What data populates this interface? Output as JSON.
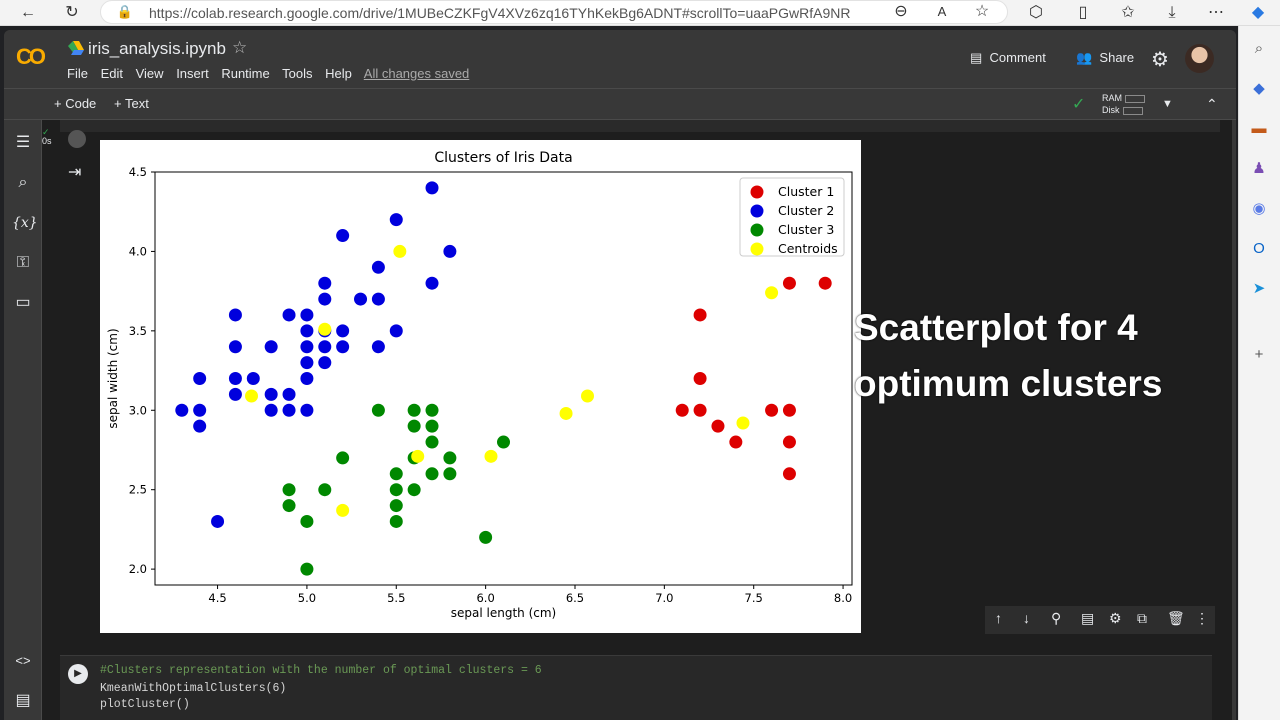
{
  "browser": {
    "url": "https://colab.research.google.com/drive/1MUBeCZKFgV4XVz6zq16TYhKekBg6ADNT#scrollTo=uaaPGwRfA9NR"
  },
  "app": {
    "logo": "CO",
    "title": "iris_analysis.ipynb",
    "menu": [
      "File",
      "Edit",
      "View",
      "Insert",
      "Runtime",
      "Tools",
      "Help"
    ],
    "saved_status": "All changes saved",
    "comment_label": "Comment",
    "share_label": "Share"
  },
  "toolbar": {
    "add_code": "+ Code",
    "add_text": "+ Text",
    "ram_label": "RAM",
    "disk_label": "Disk"
  },
  "cell": {
    "exec_time": "0s",
    "code_lines": [
      "#Clusters representation with the number of optimal clusters = 6",
      "KmeanWithOptimalClusters(6)",
      "plotCluster()"
    ]
  },
  "overlay": {
    "line1": "Scatterplot for 4",
    "line2": "optimum clusters"
  },
  "chart_data": {
    "type": "scatter",
    "title": "Clusters of Iris Data",
    "xlabel": "sepal length (cm)",
    "ylabel": "sepal width (cm)",
    "xlim": [
      4.15,
      8.05
    ],
    "ylim": [
      1.9,
      4.5
    ],
    "xticks": [
      "4.5",
      "5.0",
      "5.5",
      "6.0",
      "6.5",
      "7.0",
      "7.5",
      "8.0"
    ],
    "yticks": [
      "2.0",
      "2.5",
      "3.0",
      "3.5",
      "4.0",
      "4.5"
    ],
    "legend_position": "top-right",
    "series": [
      {
        "name": "Cluster 1",
        "color": "#dd0000",
        "points": [
          [
            7.1,
            3.0
          ],
          [
            7.2,
            3.0
          ],
          [
            7.2,
            3.6
          ],
          [
            7.2,
            3.2
          ],
          [
            7.3,
            2.9
          ],
          [
            7.4,
            2.8
          ],
          [
            7.6,
            3.0
          ],
          [
            7.7,
            3.0
          ],
          [
            7.7,
            3.8
          ],
          [
            7.7,
            2.8
          ],
          [
            7.7,
            2.6
          ],
          [
            7.9,
            3.8
          ]
        ]
      },
      {
        "name": "Cluster 2",
        "color": "#0000dd",
        "points": [
          [
            4.3,
            3.0
          ],
          [
            4.4,
            3.0
          ],
          [
            4.4,
            3.2
          ],
          [
            4.4,
            2.9
          ],
          [
            4.5,
            2.3
          ],
          [
            4.6,
            3.6
          ],
          [
            4.6,
            3.4
          ],
          [
            4.6,
            3.2
          ],
          [
            4.6,
            3.1
          ],
          [
            4.7,
            3.2
          ],
          [
            4.8,
            3.4
          ],
          [
            4.8,
            3.1
          ],
          [
            4.8,
            3.0
          ],
          [
            4.9,
            3.6
          ],
          [
            4.9,
            3.1
          ],
          [
            4.9,
            3.0
          ],
          [
            5.0,
            3.6
          ],
          [
            5.0,
            3.5
          ],
          [
            5.0,
            3.4
          ],
          [
            5.0,
            3.3
          ],
          [
            5.0,
            3.2
          ],
          [
            5.0,
            3.0
          ],
          [
            5.1,
            3.8
          ],
          [
            5.1,
            3.7
          ],
          [
            5.1,
            3.5
          ],
          [
            5.1,
            3.4
          ],
          [
            5.1,
            3.3
          ],
          [
            5.2,
            4.1
          ],
          [
            5.2,
            3.5
          ],
          [
            5.2,
            3.4
          ],
          [
            5.3,
            3.7
          ],
          [
            5.4,
            3.9
          ],
          [
            5.4,
            3.7
          ],
          [
            5.4,
            3.4
          ],
          [
            5.5,
            4.2
          ],
          [
            5.5,
            3.5
          ],
          [
            5.7,
            4.4
          ],
          [
            5.7,
            3.8
          ],
          [
            5.8,
            4.0
          ]
        ]
      },
      {
        "name": "Cluster 3",
        "color": "#008800",
        "points": [
          [
            4.9,
            2.5
          ],
          [
            4.9,
            2.4
          ],
          [
            5.0,
            2.3
          ],
          [
            5.0,
            2.0
          ],
          [
            5.1,
            2.5
          ],
          [
            5.2,
            2.7
          ],
          [
            5.4,
            3.0
          ],
          [
            5.5,
            2.6
          ],
          [
            5.5,
            2.5
          ],
          [
            5.5,
            2.4
          ],
          [
            5.5,
            2.3
          ],
          [
            5.6,
            3.0
          ],
          [
            5.6,
            2.9
          ],
          [
            5.6,
            2.7
          ],
          [
            5.6,
            2.5
          ],
          [
            5.7,
            3.0
          ],
          [
            5.7,
            2.9
          ],
          [
            5.7,
            2.8
          ],
          [
            5.7,
            2.6
          ],
          [
            5.8,
            2.7
          ],
          [
            5.8,
            2.6
          ],
          [
            6.0,
            2.2
          ],
          [
            6.1,
            2.8
          ]
        ]
      },
      {
        "name": "Centroids",
        "color": "#ffff00",
        "points": [
          [
            4.69,
            3.09
          ],
          [
            5.1,
            3.51
          ],
          [
            5.2,
            2.37
          ],
          [
            5.52,
            4.0
          ],
          [
            5.62,
            2.71
          ],
          [
            6.03,
            2.71
          ],
          [
            6.45,
            2.98
          ],
          [
            6.57,
            3.09
          ],
          [
            7.44,
            2.92
          ],
          [
            7.6,
            3.74
          ]
        ]
      }
    ]
  }
}
